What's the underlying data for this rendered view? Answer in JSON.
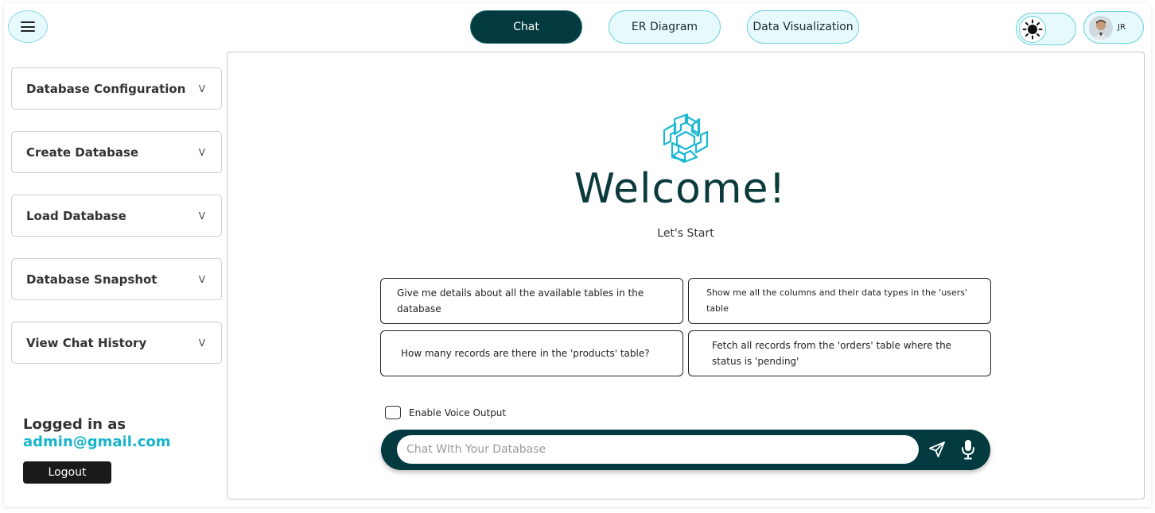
{
  "header": {
    "tabs": [
      {
        "label": "Chat",
        "active": true
      },
      {
        "label": "ER Diagram",
        "active": false
      },
      {
        "label": "Data Visualization",
        "active": false
      }
    ],
    "theme_icon": "sun-icon",
    "profile_initials": "JR"
  },
  "sidebar": {
    "items": [
      {
        "label": "Database Configuration",
        "chevron": "V"
      },
      {
        "label": "Create Database",
        "chevron": "V"
      },
      {
        "label": "Load Database",
        "chevron": "V"
      },
      {
        "label": "Database Snapshot",
        "chevron": "V"
      },
      {
        "label": "View Chat History",
        "chevron": "V"
      }
    ],
    "logged_in_label": "Logged in as",
    "user_email": "admin@gmail.com",
    "logout_label": "Logout"
  },
  "main": {
    "welcome_title": "Welcome!",
    "subtitle": "Let's Start",
    "suggestions": [
      "Give me details about all the available tables in the database",
      "Show me all the columns and their data types in the 'users' table",
      "How many records are there in the 'products' table?",
      "Fetch all records from the 'orders' table where the status is 'pending'"
    ],
    "voice_output_label": "Enable Voice Output",
    "voice_output_checked": false,
    "chat_placeholder": "Chat WIth Your Database",
    "chat_value": ""
  },
  "colors": {
    "accent_dark": "#033a3f",
    "accent_light": "#e6f9fc",
    "accent_border": "#6ccfdc",
    "email_color": "#18b4cc",
    "logo_color": "#1cb8d2"
  }
}
